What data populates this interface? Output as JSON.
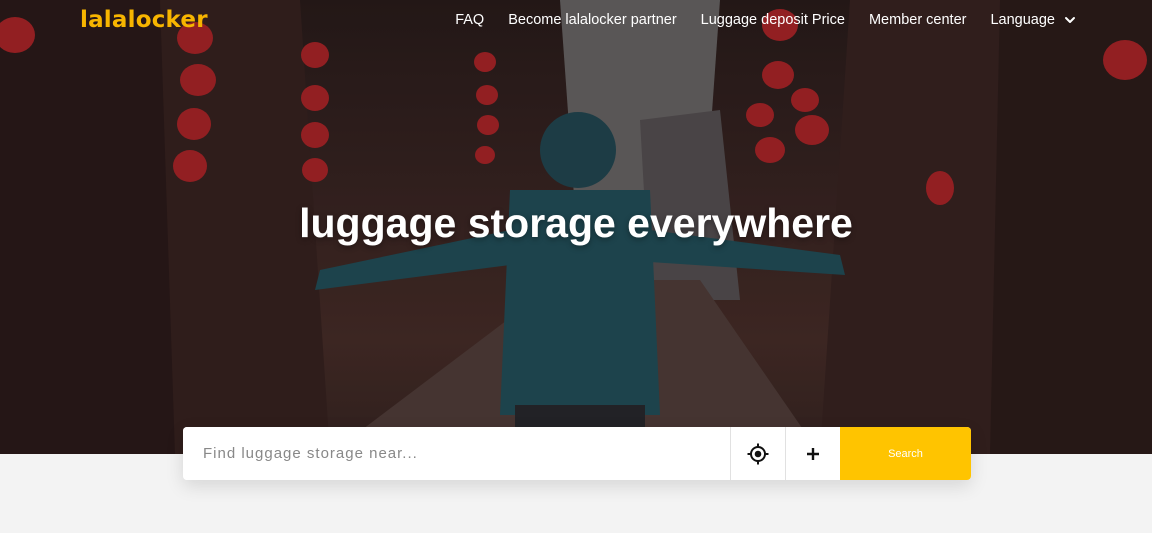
{
  "brand": {
    "logo_text": "lalalocker",
    "accent_color": "#f7b500"
  },
  "nav": {
    "items": [
      {
        "label": "FAQ"
      },
      {
        "label": "Become lalalocker partner"
      },
      {
        "label": "Luggage deposit Price"
      },
      {
        "label": "Member center"
      },
      {
        "label": "Language",
        "icon": "chevron-down-icon"
      }
    ]
  },
  "hero": {
    "headline": "luggage storage everywhere"
  },
  "search": {
    "placeholder": "Find luggage storage near...",
    "value": "",
    "location_icon": "crosshair-icon",
    "add_icon": "plus-icon",
    "button_label": "Search",
    "button_color": "#ffc400"
  }
}
